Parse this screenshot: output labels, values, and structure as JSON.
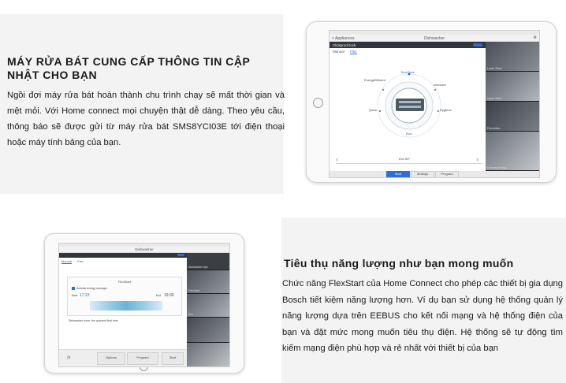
{
  "section1": {
    "heading": "MÁY RỬA BÁT CUNG CẤP THÔNG TIN CẬP NHẬT CHO BẠN",
    "paragraph": "Ngồi đợi máy rửa bát hoàn thành chu trình chạy sẽ mất thời gian và mệt mỏi. Với Home connect mọi chuyện thật dễ dàng. Theo yêu cầu, thông báo sẽ được gửi từ máy rửa bát SMS8YCI03E tới điện thoại hoặc máy tính bảng của bạn."
  },
  "section2": {
    "heading": "Tiêu thụ năng lượng như bạn mong muốn",
    "paragraph": "Chức năng FlexStart của Home Connect cho phép các thiết bị gia dụng Bosch tiết kiệm năng lượng hơn. Ví dụ bạn sử dụng hệ thống quản lý năng lượng dựa trên EEBUS cho kết nối mạng và hệ thống điện của bạn và đặt mức mong muốn tiêu thụ điện. Hệ thống sẽ tự động tìm kiếm mạng điện phù hợp và rẻ nhất với thiết bị của bạn"
  },
  "tablet1": {
    "back_label": "< Appliances",
    "title": "Dishwasher",
    "program_label": "Clickproof lock",
    "tabs": [
      "Manual",
      "Flex"
    ],
    "wheel_labels": [
      "EnergyEfficient",
      "TimeSave",
      "Quick",
      "Intensive",
      "Hygiene"
    ],
    "center_label": "Eco",
    "bottom_label": "Eco 50°",
    "sidebar_labels": [
      "Lower Rack",
      "Upper Rack",
      "Favourites",
      "Dishwasher tips"
    ],
    "nav": [
      "Start",
      "Settings",
      "Program"
    ]
  },
  "tablet2": {
    "title": "Dishwasher",
    "tabs": [
      "Manual",
      "Flex"
    ],
    "panel_title": "FlexStart",
    "checkbox_label": "Activate energy manager",
    "start_label": "Start",
    "start_time": "17:23",
    "end_label": "End",
    "end_time": "19:30",
    "note": "Dishwasher done: the quickest final time",
    "buttons": [
      "Options",
      "Program",
      "Start"
    ],
    "sidebar_labels": [
      "Dishwasher tips",
      "FlexStart",
      "Eco"
    ]
  },
  "colors": {
    "panel_bg": "#f3f3f3",
    "accent": "#2a6fd6",
    "sidebar_dark": "#2a2d31"
  }
}
